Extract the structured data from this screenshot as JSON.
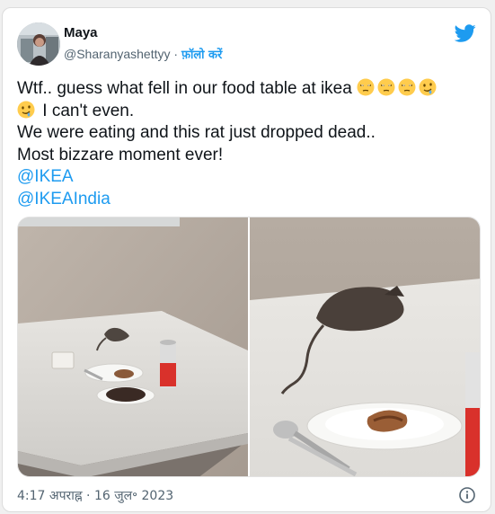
{
  "author": {
    "name": "Maya",
    "handle": "@Sharanyashettyy",
    "separator": "·",
    "follow_label": "फ़ॉलो करें"
  },
  "tweet": {
    "line1_text": "Wtf.. guess what fell in our food table at ikea",
    "line2_text": "I can't even.",
    "line3_text": "We were eating and this rat just dropped dead..",
    "line4_text": "Most bizzare moment ever!",
    "mentions": [
      "@IKEA",
      "@IKEAIndia"
    ],
    "emoji_icons": [
      "unamused-face-icon",
      "unamused-face-icon",
      "unamused-face-icon",
      "drooling-face-icon",
      "drooling-face-icon"
    ]
  },
  "timestamp": "4:17 अपराह्न · 16 जुल॰ 2023",
  "colors": {
    "accent": "#1d9bf0",
    "text_primary": "#0f1419",
    "text_secondary": "#536471"
  }
}
